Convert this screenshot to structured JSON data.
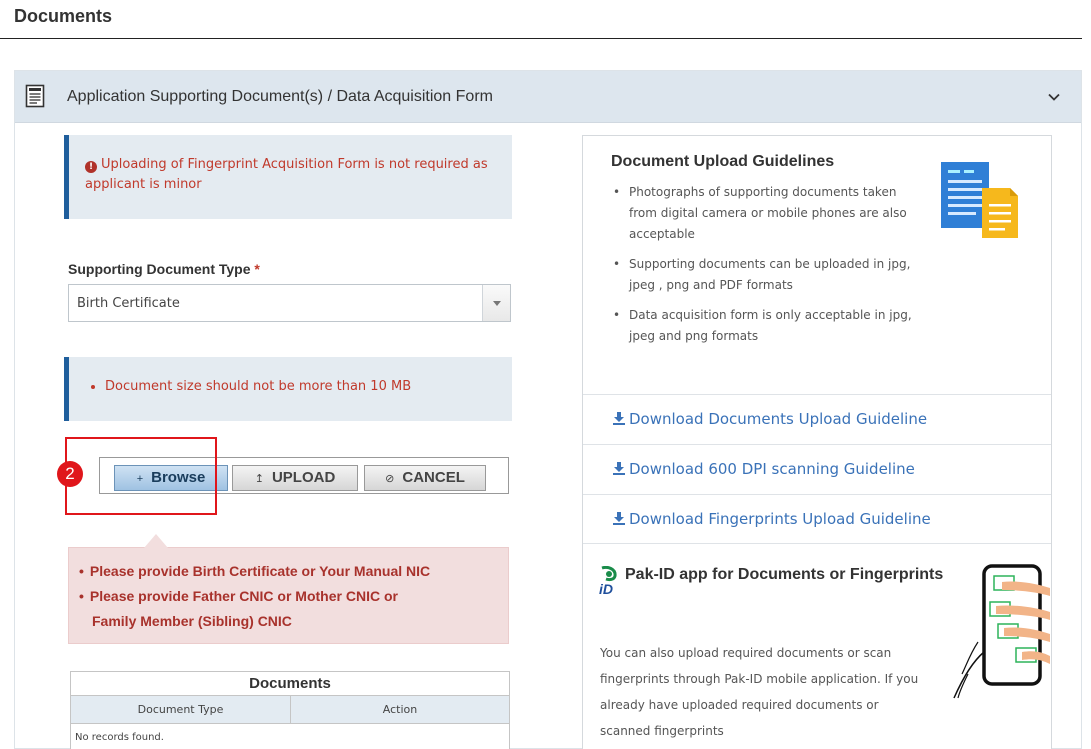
{
  "page": {
    "heading": "Documents"
  },
  "panel": {
    "title": "Application Supporting Document(s) / Data Acquisition Form",
    "icon": "document-icon",
    "toggle_icon": "chevron-down-icon"
  },
  "alerts": {
    "minor_notice": "Uploading of Fingerprint Acquisition Form is not required as applicant is minor",
    "size_notice": "Document size should not be more than 10 MB",
    "errors": [
      {
        "line1": "Please provide Birth Certificate or Your Manual NIC",
        "line2": ""
      },
      {
        "line1": "Please provide Father CNIC or Mother CNIC or",
        "line2": "Family Member (Sibling) CNIC"
      }
    ]
  },
  "form": {
    "doc_type_label": "Supporting Document Type",
    "required_mark": "*",
    "doc_type_value": "Birth Certificate"
  },
  "upload_bar": {
    "browse_glyph": "+",
    "browse_label": "Browse",
    "upload_glyph": "↥",
    "upload_label": "UPLOAD",
    "cancel_glyph": "⊘",
    "cancel_label": "CANCEL"
  },
  "annotation": {
    "step_number": "2",
    "highlight_color": "#e0161b"
  },
  "documents_table": {
    "title": "Documents",
    "columns": [
      "Document Type",
      "Action"
    ],
    "empty_text": "No records found."
  },
  "guidelines": {
    "title": "Document Upload Guidelines",
    "items": [
      "Photographs of supporting documents taken from digital camera or mobile phones are also acceptable",
      "Supporting documents can be uploaded in jpg, jpeg , png and PDF formats",
      "Data acquisition form is only acceptable in jpg, jpeg and png formats"
    ],
    "downloads": [
      "Download Documents Upload Guideline",
      "Download 600 DPI scanning Guideline",
      "Download Fingerprints Upload Guideline"
    ],
    "link_color": "#3a72b8"
  },
  "pakid": {
    "title": "Pak-ID app for Documents or Fingerprints",
    "text": "You can also upload required documents or scan fingerprints through Pak-ID mobile application. If you already have uploaded required documents or scanned fingerprints"
  }
}
